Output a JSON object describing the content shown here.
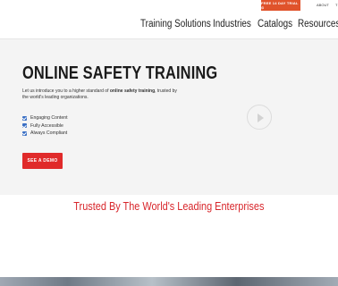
{
  "topbar": {
    "trial_label": "FREE 14 DAY TRIAL ⊙",
    "links": [
      "ABOUT",
      "T"
    ]
  },
  "nav": {
    "items": [
      "Training Solutions",
      "Industries",
      "Catalogs",
      "Resources"
    ]
  },
  "hero": {
    "title": "ONLINE SAFETY TRAINING",
    "intro_before": "Let us introduce you to a higher standard of ",
    "intro_bold": "online safety training",
    "intro_after": ", trusted by the world's leading organizations.",
    "features": [
      "Engaging Content",
      "Fully Accessible",
      "Always Compliant"
    ],
    "cta_label": "SEE A DEMO",
    "play_icon": "play-icon"
  },
  "trusted": {
    "heading": "Trusted By The World's Leading Enterprises"
  },
  "colors": {
    "accent_red": "#e02a2a",
    "trial_orange": "#e0532b",
    "heading_red": "#d8262b",
    "check_blue": "#3a6fc4"
  }
}
